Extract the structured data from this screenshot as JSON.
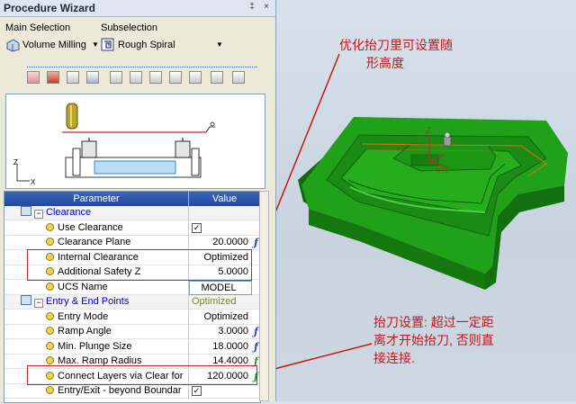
{
  "window": {
    "title": "Procedure Wizard",
    "pin_glyph": "‡",
    "close_glyph": "×"
  },
  "selection": {
    "main_label": "Main Selection",
    "main_value": "Volume Milling",
    "sub_label": "Subselection",
    "sub_value": "Rough Spiral"
  },
  "toolbar_icons": [
    "eraser-icon",
    "tool-icon",
    "layers-icon",
    "stock-icon",
    "machine-icon",
    "transfer-icon",
    "ramp-icon",
    "path-icon",
    "level-icon",
    "cut-icon",
    "params-icon"
  ],
  "preview": {
    "axis_z": "Z",
    "axis_x": "X"
  },
  "table": {
    "col_param": "Parameter",
    "col_value": "Value",
    "rows": [
      {
        "kind": "group",
        "label": "Clearance",
        "value": ""
      },
      {
        "kind": "item",
        "label": "Use Clearance",
        "value": "✓",
        "type": "check"
      },
      {
        "kind": "item",
        "label": "Clearance Plane",
        "value": "20.0000",
        "mark": "ƒ"
      },
      {
        "kind": "item",
        "label": "Internal Clearance",
        "value": "Optimized",
        "mark": ""
      },
      {
        "kind": "item",
        "label": "Additional Safety Z",
        "value": "5.0000",
        "mark": ""
      },
      {
        "kind": "item",
        "label": "UCS Name",
        "value": "MODEL",
        "mark": ""
      },
      {
        "kind": "group",
        "label": "Entry & End Points",
        "value": "Optimized"
      },
      {
        "kind": "item",
        "label": "Entry Mode",
        "value": "Optimized",
        "mark": ""
      },
      {
        "kind": "item",
        "label": "Ramp Angle",
        "value": "3.0000",
        "mark": "ƒ"
      },
      {
        "kind": "item",
        "label": "Min. Plunge Size",
        "value": "18.0000",
        "mark": "ƒ"
      },
      {
        "kind": "item",
        "label": "Max. Ramp Radius",
        "value": "14.4000",
        "mark": "ƒ"
      },
      {
        "kind": "item",
        "label": "Connect Layers via Clear for",
        "value": "120.0000",
        "mark": "ƒ"
      },
      {
        "kind": "item",
        "label": "Entry/Exit - beyond Boundar",
        "value": "✓",
        "type": "check"
      }
    ]
  },
  "viewport": {
    "axis_z": "Z",
    "axis_label": "XYZ",
    "note_top": [
      "优化抬刀里可设置随",
      "形高度"
    ],
    "note_bottom": [
      "抬刀设置: 超过一定距",
      "离才开始抬刀, 否则直",
      "接连接."
    ]
  },
  "colors": {
    "model_green": "#1f9a18",
    "annotation_red": "#c4161c",
    "header_blue": "#2f56ac",
    "mark_blue": "#1c3fd0",
    "mark_green": "#1a9a1a"
  }
}
